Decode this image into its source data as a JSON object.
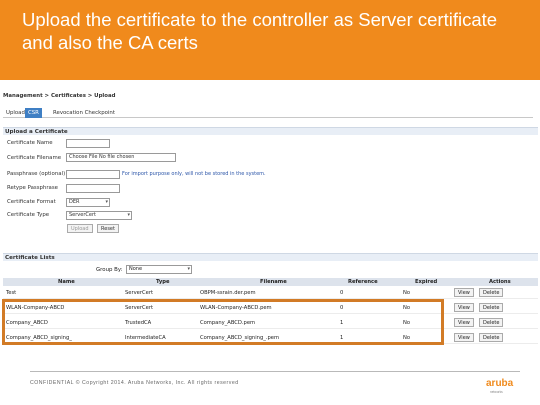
{
  "slide": {
    "title": "Upload the certificate to the controller as Server certificate and also the CA certs",
    "accent_color": "#f08a1c",
    "footer": "CONFIDENTIAL © Copyright 2014. Aruba Networks, Inc. All rights reserved",
    "logo": {
      "word": "aruba",
      "subtitle": "networks"
    }
  },
  "ui": {
    "breadcrumb": "Management > Certificates > Upload",
    "tabs": [
      {
        "label": "Upload",
        "active": false
      },
      {
        "label": "CSR",
        "active": true
      },
      {
        "label": "Revocation Checkpoint",
        "active": false
      }
    ],
    "upload_section": {
      "title": "Upload a Certificate",
      "fields": [
        {
          "label": "Certificate Name",
          "value": ""
        },
        {
          "label": "Certificate Filename",
          "value": "Choose File  No file chosen"
        },
        {
          "label": "Passphrase (optional)",
          "value": "",
          "hint": "For import purpose only, will not be stored in the system."
        },
        {
          "label": "Retype Passphrase",
          "value": ""
        },
        {
          "label": "Certificate Format",
          "value": "DER"
        },
        {
          "label": "Certificate Type",
          "value": "ServerCert"
        }
      ],
      "upload_button": "Upload",
      "reset_button": "Reset"
    },
    "lists_section": {
      "title": "Certificate Lists",
      "group_by_label": "Group By:",
      "group_by_value": "None",
      "columns": [
        "Name",
        "Type",
        "Filename",
        "Reference",
        "Expired",
        "Actions"
      ],
      "rows": [
        {
          "name": "Test",
          "type": "ServerCert",
          "filename": "OBPM-ssrain.der.pem",
          "reference": "0",
          "expired": "No"
        },
        {
          "name": "WLAN-Company-ABCD",
          "type": "ServerCert",
          "filename": "WLAN-Company-ABCD.pem",
          "reference": "0",
          "expired": "No"
        },
        {
          "name": "Company_ABCD",
          "type": "TrustedCA",
          "filename": "Company_ABCD.pem",
          "reference": "1",
          "expired": "No"
        },
        {
          "name": "Company_ABCD_signing_",
          "type": "IntermediateCA",
          "filename": "Company_ABCD_signing_.pem",
          "reference": "1",
          "expired": "No"
        }
      ],
      "view_button": "View",
      "delete_button": "Delete"
    }
  }
}
